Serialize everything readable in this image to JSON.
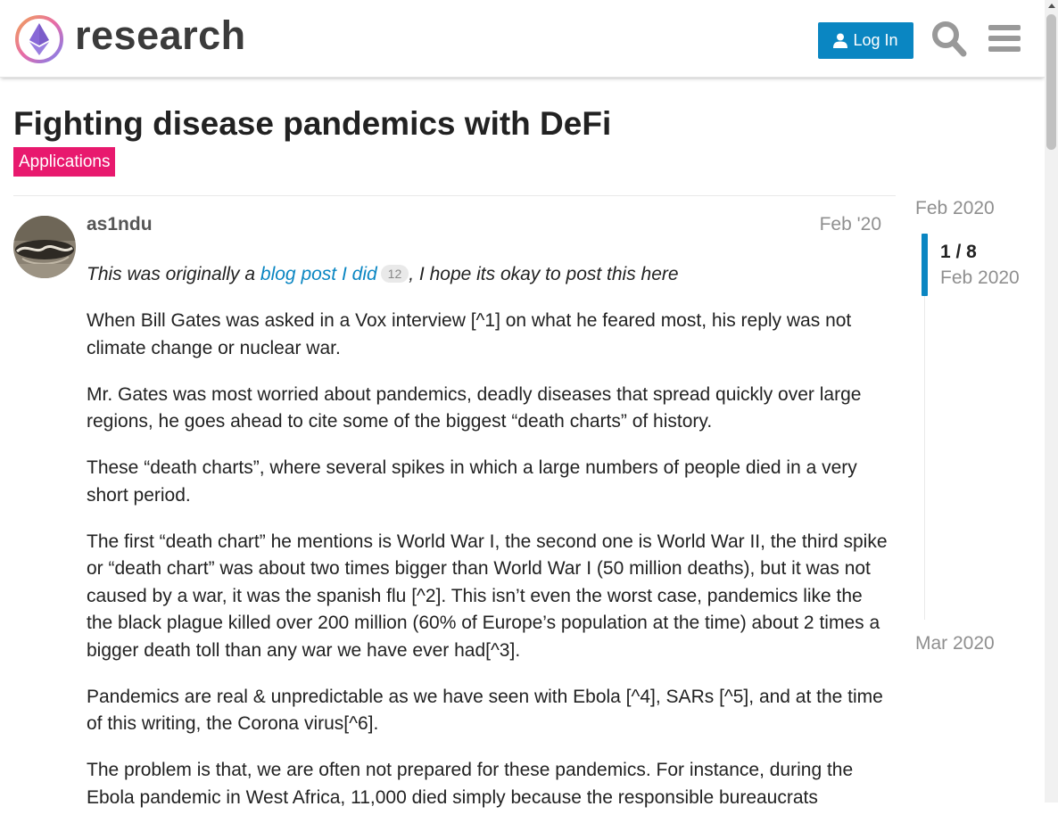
{
  "header": {
    "logo_text": "research",
    "login_label": "Log In",
    "icons": {
      "search": "search-icon",
      "menu": "hamburger-menu-icon",
      "user": "user-icon"
    }
  },
  "topic": {
    "title": "Fighting disease pandemics with DeFi",
    "category": "Applications",
    "category_color": "#e8196e"
  },
  "post": {
    "username": "as1ndu",
    "date": "Feb '20",
    "intro_before": "This was originally a ",
    "intro_link": "blog post I did",
    "intro_clicks": "12",
    "intro_after": ", I hope its okay to post this here",
    "paragraphs": [
      "When Bill Gates was asked in a Vox interview [^1] on what he feared most, his reply was not climate change or nuclear war.",
      "Mr. Gates was most worried about pandemics, deadly diseases that spread quickly over large regions, he goes ahead to cite some of the biggest “death charts” of history.",
      "These “death charts”, where several spikes in which a large numbers of people died in a very short period.",
      "The first “death chart” he mentions is World War I, the second one is World War II, the third spike or “death chart” was about two times bigger than World War I (50 million deaths), but it was not caused by a war, it was the spanish flu [^2]. This isn’t even the worst case, pandemics like the the black plague killed over 200 million (60% of Europe’s population at the time) about 2 times a bigger death toll than any war we have ever had[^3].",
      "Pandemics are real & unpredictable as we have seen with Ebola [^4], SARs [^5], and at the time of this writing, the Corona virus[^6].",
      "The problem is that, we are often not prepared for these pandemics. For instance, during the Ebola pandemic in West Africa, 11,000 died simply because the responsible bureaucrats"
    ]
  },
  "timeline": {
    "start_date": "Feb 2020",
    "position": "1 / 8",
    "current_date": "Feb 2020",
    "end_date": "Mar 2020"
  },
  "colors": {
    "accent": "#0a86c2",
    "category": "#e8196e",
    "muted_text": "#8f8f8f"
  }
}
